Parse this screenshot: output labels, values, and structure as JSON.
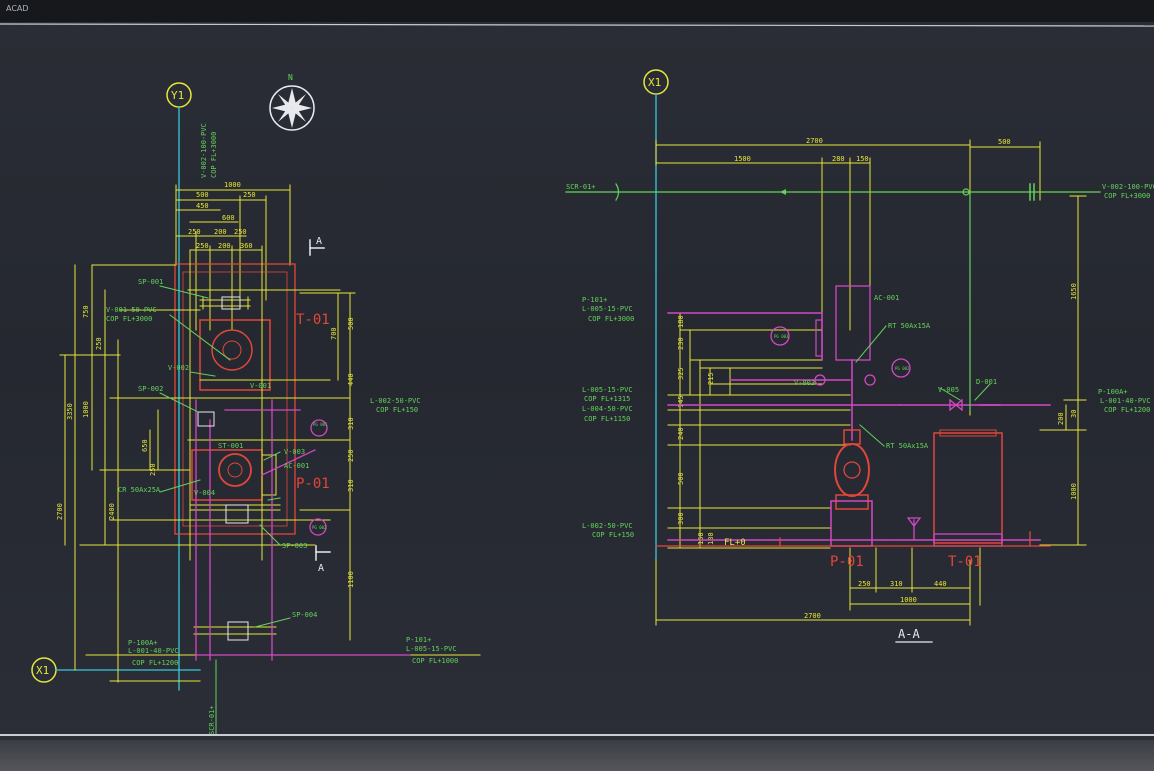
{
  "window": {
    "title_bar_text": "ACAD"
  },
  "colors": {
    "yellow": "#e6e63a",
    "cyan": "#37c8d8",
    "green": "#63d35a",
    "red": "#e2463a",
    "magenta": "#d348c4",
    "white": "#e7e9ee",
    "background": "#262a31"
  },
  "left_view": {
    "grid_label_y1": "Y1",
    "grid_label_x1": "X1",
    "north_label": "N",
    "vline_label_top": "V-002-100-PVC",
    "vline_label_top2": "COP FL+3000",
    "dims_top": [
      "1000",
      "500",
      "250",
      "450",
      "600",
      "250",
      "200",
      "250",
      "250",
      "200",
      "360"
    ],
    "tank_label": "T-01",
    "pump_label": "P-01",
    "section_mark_top": "A",
    "section_mark_bottom": "A",
    "sp_labels": [
      "SP-001",
      "SP-002",
      "SP-003",
      "SP-004"
    ],
    "v_labels": [
      "V-001",
      "V-002",
      "V-003",
      "V-004"
    ],
    "line_v001": "V-001-50-PVC",
    "line_v001_cop": "COP FL+3000",
    "line_l002": "L-002-50-PVC",
    "line_l002_cop": "COP FL+150",
    "cr_label": "CR 50Ax25A",
    "st_label": "ST-001",
    "ac_label": "AC-001",
    "pg_labels": [
      "PG 001",
      "PG 002"
    ],
    "dims_left": [
      "750",
      "250",
      "1000",
      "3350",
      "2700",
      "2400",
      "650",
      "250"
    ],
    "dims_right": [
      "500",
      "700",
      "440",
      "310",
      "250",
      "310",
      "1100"
    ],
    "bottom_left_label1": "P-100A+",
    "bottom_left_label2": "L-001-40-PVC",
    "bottom_left_label3": "COP FL+1200",
    "bottom_right_label1": "P-101+",
    "bottom_right_label2": "L-005-15-PVC",
    "bottom_right_label3": "COP FL+1000",
    "scr_label": "SCR-01+"
  },
  "right_view": {
    "grid_label_x1": "X1",
    "dims_top": [
      "2700",
      "1500",
      "280",
      "150",
      "500"
    ],
    "scr_label": "SCR-01+",
    "v002_label": "V-002-100-PVC",
    "v002_cop": "COP FL+3000",
    "dim_1650": "1650",
    "p101_label": "P-101+",
    "l005_label": "L-005-15-PVC",
    "l005_cop": "COP FL+3000",
    "ac_label": "AC-001",
    "pg_label1": "PG 003",
    "pg_label2": "PG 002",
    "rt_label1": "RT 50Ax15A",
    "rt_label2": "RT 50Ax15A",
    "v003_label": "V-003",
    "v005_label": "V-005",
    "d001_label": "D-001",
    "l005b_label": "L-005-15-PVC",
    "l005b_cop": "COP FL+1315",
    "l004_label": "L-004-50-PVC",
    "l004_cop": "COP FL+1150",
    "p100a_label": "P-100A+",
    "l001_label": "L-001-40-PVC",
    "l001_cop": "COP FL+1200",
    "l002_label": "L-002-50-PVC",
    "l002_cop": "COP FL+150",
    "fl_label": "FL+0",
    "pump_label": "P-01",
    "tank_label": "T-01",
    "dims_bottom": [
      "250",
      "310",
      "440",
      "1000",
      "2700"
    ],
    "dims_left": [
      "180",
      "230",
      "325",
      "215",
      "145",
      "240",
      "500",
      "300",
      "150",
      "180"
    ],
    "dims_right": [
      "200",
      "30",
      "1000"
    ],
    "section_title": "A-A"
  }
}
